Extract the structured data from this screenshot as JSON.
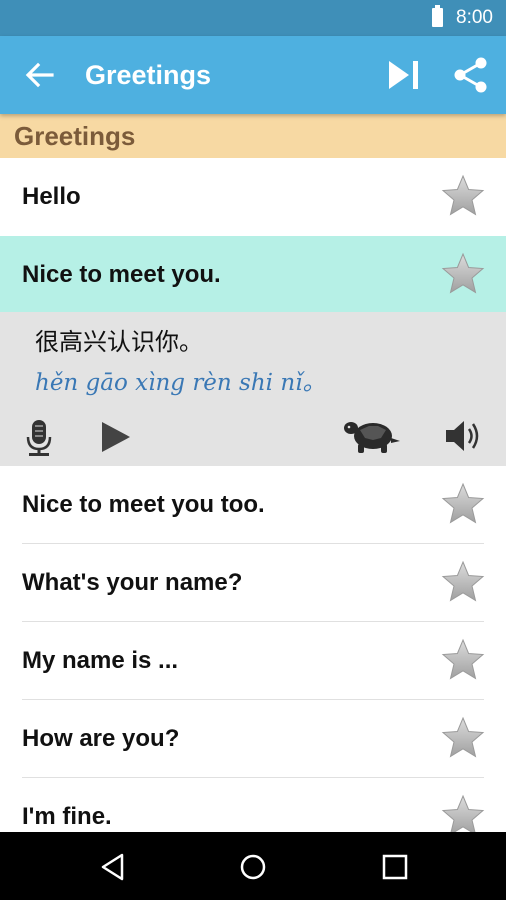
{
  "status_bar": {
    "time": "8:00"
  },
  "app_bar": {
    "title": "Greetings"
  },
  "section": {
    "title": "Greetings"
  },
  "phrases": [
    {
      "text": "Hello",
      "starred": false
    },
    {
      "text": "Nice to meet you.",
      "starred": false,
      "expanded": true
    },
    {
      "text": "Nice to meet you too.",
      "starred": false
    },
    {
      "text": "What's your name?",
      "starred": false
    },
    {
      "text": "My name is ...",
      "starred": false
    },
    {
      "text": "How are you?",
      "starred": false
    },
    {
      "text": "I'm fine.",
      "starred": false
    }
  ],
  "detail": {
    "chinese": "很高兴认识你。",
    "pinyin": "hěn gāo xìng rèn shi nǐ。"
  },
  "colors": {
    "app_bar": "#4eb0e0",
    "status_bar": "#3f8fb8",
    "section_header": "#f7d9a3",
    "active_row": "#b6f0e6",
    "pinyin": "#3a78b5"
  },
  "icons": {
    "back": "arrow-left-icon",
    "skip": "skip-next-icon",
    "share": "share-icon",
    "star": "star-icon",
    "mic": "microphone-icon",
    "play": "play-icon",
    "slow": "turtle-icon",
    "volume": "volume-icon"
  }
}
